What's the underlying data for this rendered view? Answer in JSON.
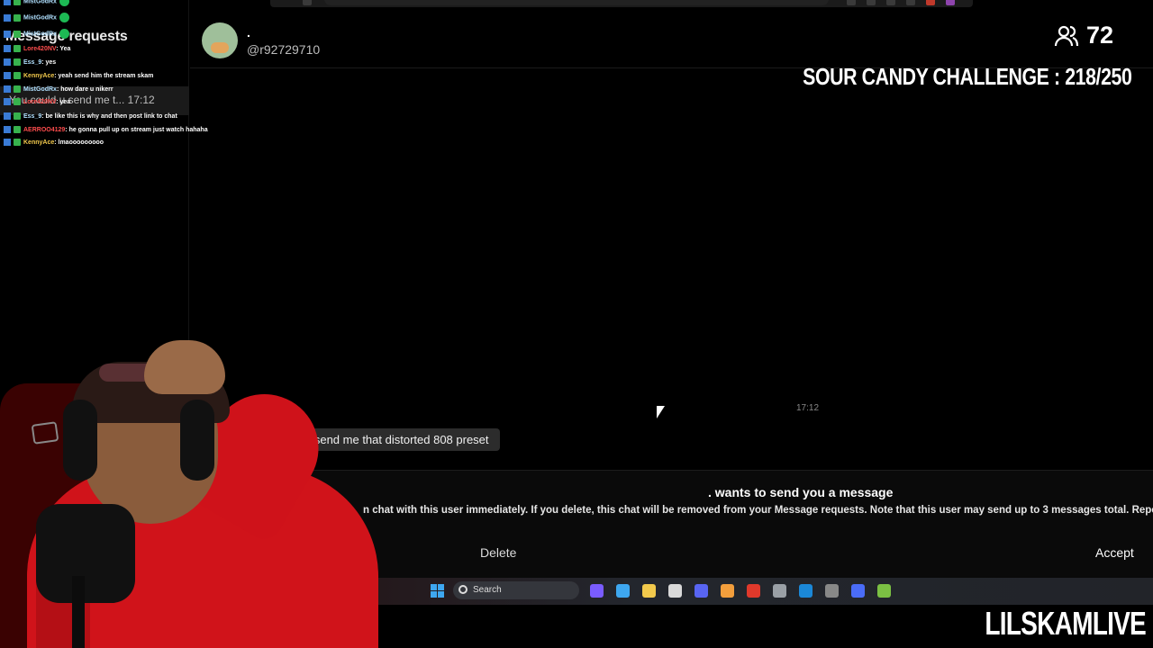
{
  "left_panel": {
    "title": "Message requests",
    "request_preview": "You could u send me t... 17:12"
  },
  "chat": [
    {
      "user": "MistGodRx",
      "text": "",
      "user_color": "#b0e0ff"
    },
    {
      "user": "MistGodRx",
      "text": "",
      "user_color": "#b0e0ff"
    },
    {
      "user": "MistGodRx",
      "text": "",
      "user_color": "#b0e0ff"
    },
    {
      "user": "Lore420NV",
      "text": ": Yea",
      "user_color": "#ff4d4d"
    },
    {
      "user": "Ess_9",
      "text": ": yes",
      "user_color": "#b0e0ff"
    },
    {
      "user": "KennyAce",
      "text": ": yeah send him the stream skam",
      "user_color": "#f2c94c"
    },
    {
      "user": "MistGodRx",
      "text": ": how dare u nikerr",
      "user_color": "#b0e0ff"
    },
    {
      "user": "Lore420NV",
      "text": ": yea",
      "user_color": "#ff4d4d"
    },
    {
      "user": "Ess_9",
      "text": ": be like this is why and then post link to chat",
      "user_color": "#b0e0ff"
    },
    {
      "user": "AERROO4129",
      "text": ": he gonna pull up on stream just watch hahaha",
      "user_color": "#ff4d4d"
    },
    {
      "user": "KennyAce",
      "text": ": lmaooooooooo",
      "user_color": "#f2c94c"
    }
  ],
  "conversation": {
    "name": ".",
    "handle": "@r92729710",
    "message_time": "17:12",
    "message_text": "u send me that distorted 808 preset"
  },
  "request_banner": {
    "title": ". wants to send you a message",
    "description": "n chat with this user immediately. If you delete, this chat will be removed from your Message requests. Note that this user may send up to 3 messages total. Report this",
    "delete_label": "Delete",
    "accept_label": "Accept"
  },
  "overlay": {
    "viewer_count": "72",
    "challenge": "SOUR CANDY CHALLENGE : 218/250",
    "watermark": "LILSKAMLIVE"
  },
  "taskbar": {
    "search_label": "Search",
    "apps": [
      "copilot-icon",
      "file-explorer-icon",
      "store-icon",
      "discord-icon",
      "fl-studio-icon",
      "brave-icon",
      "obs-icon",
      "steam-icon",
      "app-icon",
      "4k-downloader-icon",
      "bluestacks-icon",
      "notepad-icon"
    ]
  },
  "colors": {
    "accent_red": "#d0131a",
    "panel_bg": "#000000",
    "bubble_bg": "#2c2c2c"
  }
}
